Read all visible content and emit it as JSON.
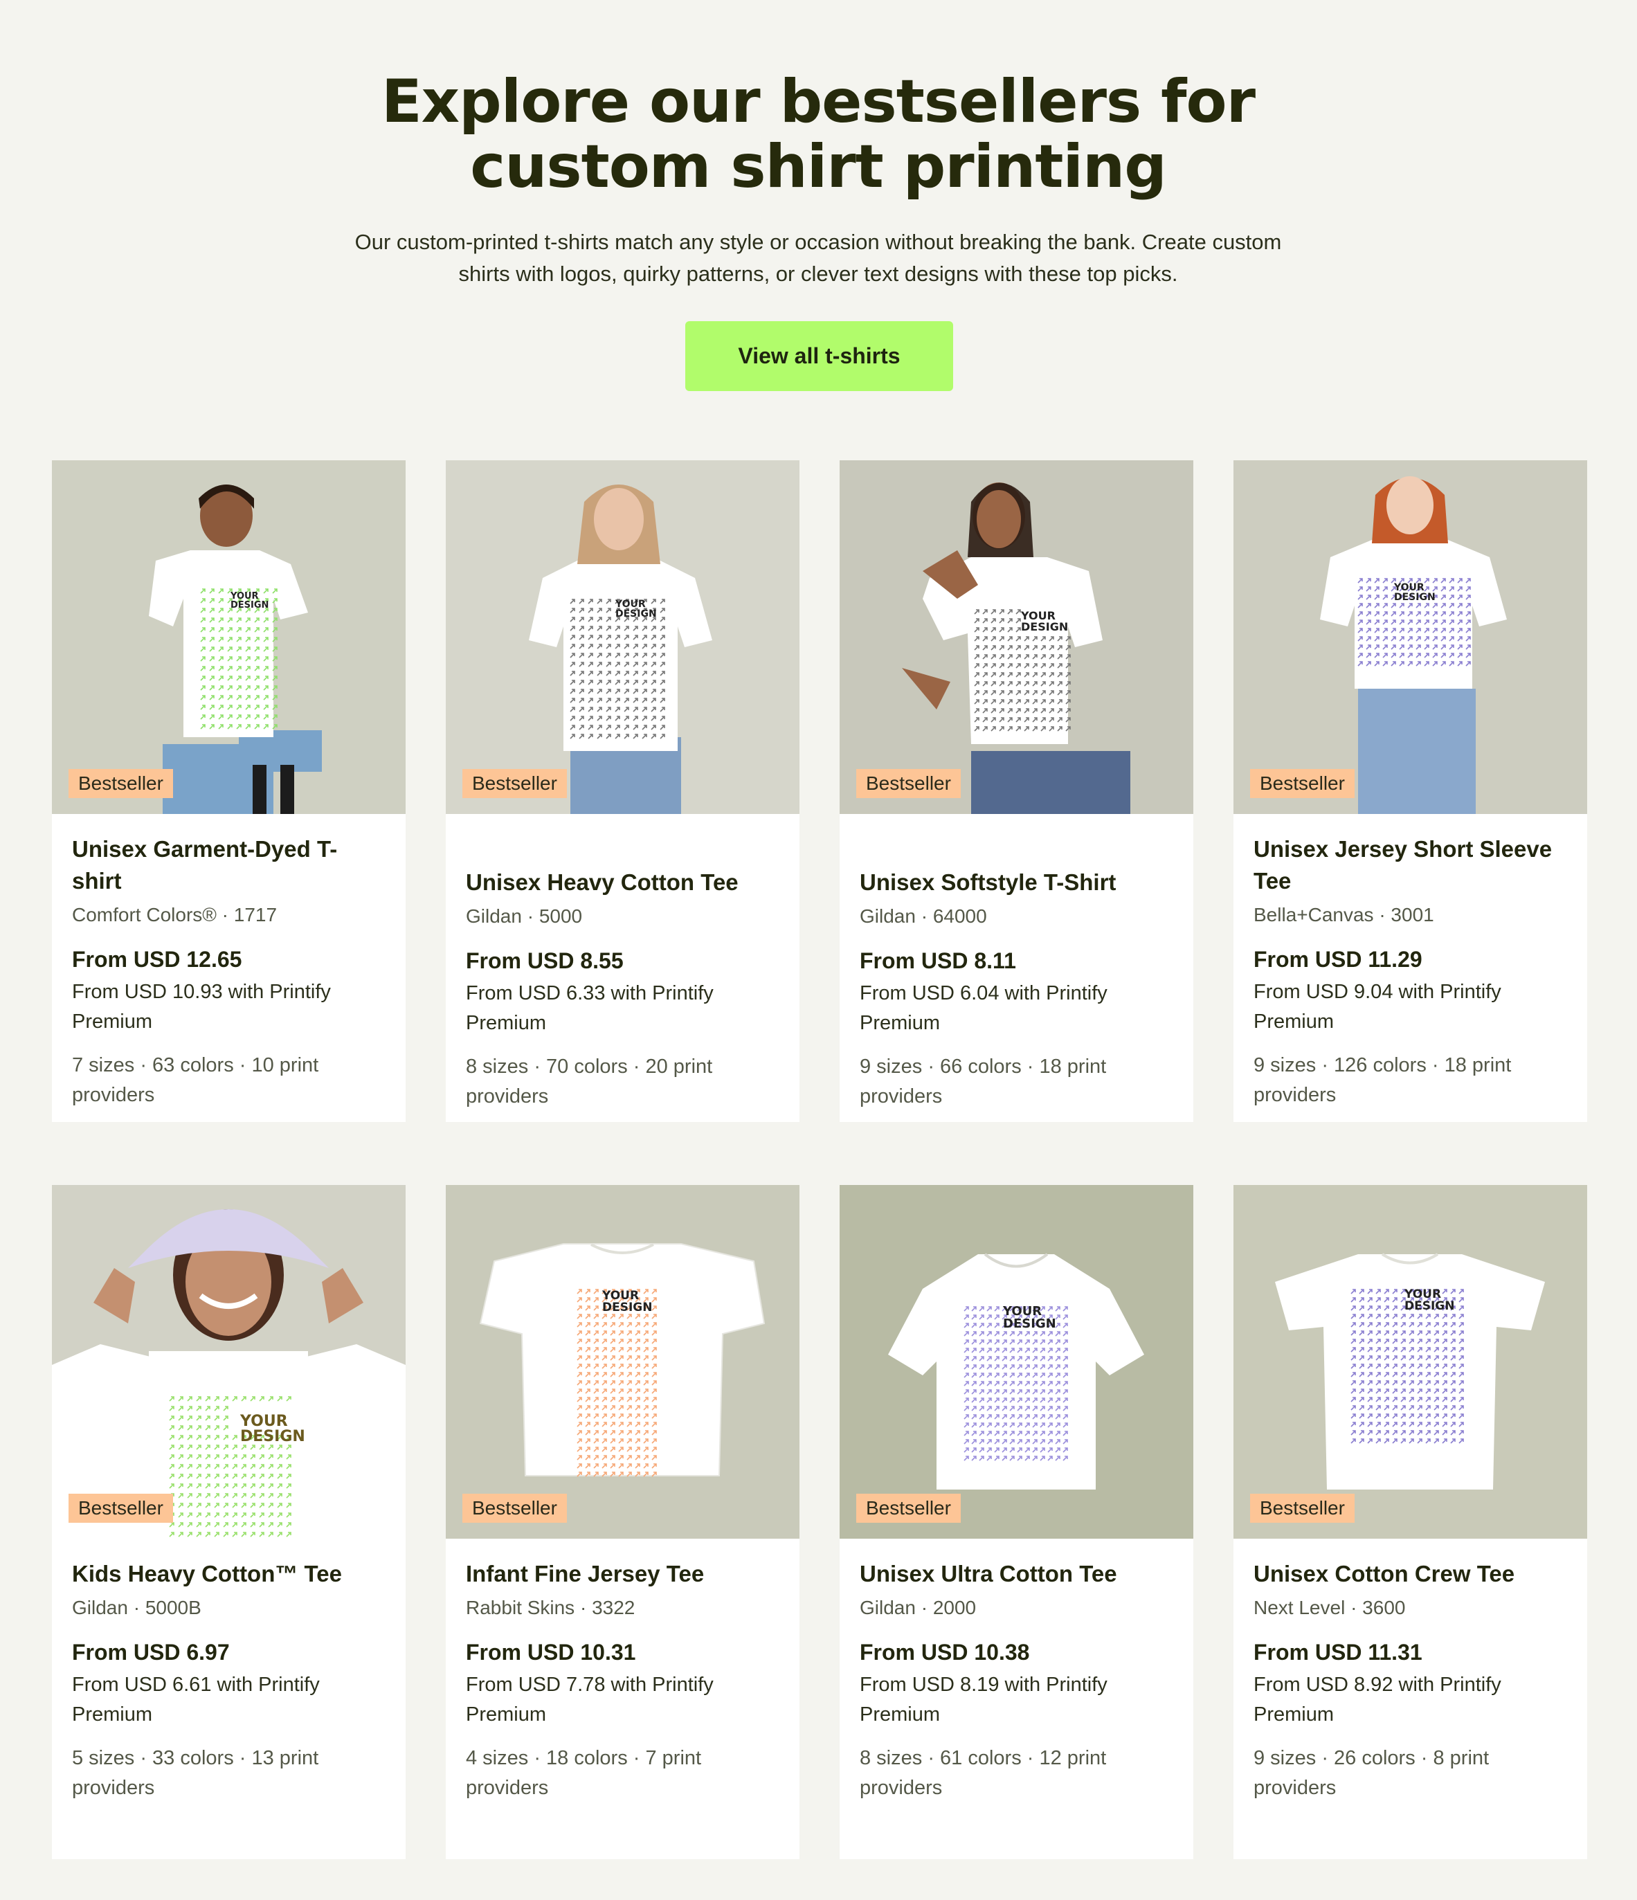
{
  "header": {
    "title": "Explore our bestsellers for custom shirt printing",
    "subtitle": "Our custom-printed t-shirts match any style or occasion without breaking the bank. Create custom shirts with logos, quirky patterns, or clever text designs with these top picks.",
    "cta_label": "View all t-shirts"
  },
  "print_text": [
    "YOUR",
    "DESIGN"
  ],
  "products": [
    {
      "badge": "Bestseller",
      "title": "Unisex Garment-Dyed T-shirt",
      "brand": "Comfort Colors® · 1717",
      "price": "From USD 12.65",
      "premium": "From USD 10.93 with Printify Premium",
      "meta": "7 sizes · 63 colors · 10 print providers",
      "image": "man-seated-pattern-tee",
      "pattern_color": "#8fe06a"
    },
    {
      "badge": "Bestseller",
      "title": "Unisex Heavy Cotton Tee",
      "brand": "Gildan · 5000",
      "price": "From USD 8.55",
      "premium": "From USD 6.33 with Printify Premium",
      "meta": "8 sizes · 70 colors · 20 print providers",
      "image": "woman-standing-pattern-tee",
      "pattern_color": "#777777"
    },
    {
      "badge": "Bestseller",
      "title": "Unisex Softstyle T-Shirt",
      "brand": "Gildan · 64000",
      "price": "From USD 8.11",
      "premium": "From USD 6.04 with Printify Premium",
      "meta": "9 sizes · 66 colors · 18 print providers",
      "image": "woman-seated-pattern-tee",
      "pattern_color": "#777777"
    },
    {
      "badge": "Bestseller",
      "title": "Unisex Jersey Short Sleeve Tee",
      "brand": "Bella+Canvas · 3001",
      "price": "From USD 11.29",
      "premium": "From USD 9.04 with Printify Premium",
      "meta": "9 sizes · 126 colors · 18 print providers",
      "image": "woman-redhead-pattern-tee",
      "pattern_color": "#8a7fd0"
    },
    {
      "badge": "Bestseller",
      "title": "Kids Heavy Cotton™ Tee",
      "brand": "Gildan · 5000B",
      "price": "From USD 6.97",
      "premium": "From USD 6.61 with Printify Premium",
      "meta": "5 sizes · 33 colors · 13 print providers",
      "image": "girl-bucket-hat-pattern-tee",
      "pattern_color": "#98e06a"
    },
    {
      "badge": "Bestseller",
      "title": "Infant Fine Jersey Tee",
      "brand": "Rabbit Skins · 3322",
      "price": "From USD 10.31",
      "premium": "From USD 7.78 with Printify Premium",
      "meta": "4 sizes · 18 colors · 7 print providers",
      "image": "flat-tee-orange-pattern",
      "pattern_color": "#f6a877"
    },
    {
      "badge": "Bestseller",
      "title": "Unisex Ultra Cotton Tee",
      "brand": "Gildan · 2000",
      "price": "From USD 10.38",
      "premium": "From USD 8.19 with Printify Premium",
      "meta": "8 sizes · 61 colors · 12 print providers",
      "image": "hanging-tee-purple-pattern",
      "pattern_color": "#9b8fdc"
    },
    {
      "badge": "Bestseller",
      "title": "Unisex Cotton Crew Tee",
      "brand": "Next Level · 3600",
      "price": "From USD 11.31",
      "premium": "From USD 8.92 with Printify Premium",
      "meta": "9 sizes · 26 colors · 8 print providers",
      "image": "flat-tee-purple-pattern",
      "pattern_color": "#8a7fd0"
    }
  ],
  "colors": {
    "background": "#f4f4ef",
    "cta": "#b1fc6b",
    "badge": "#fdc596",
    "photo_backdrop": "#cfd0c2",
    "heading": "#262a0c"
  }
}
